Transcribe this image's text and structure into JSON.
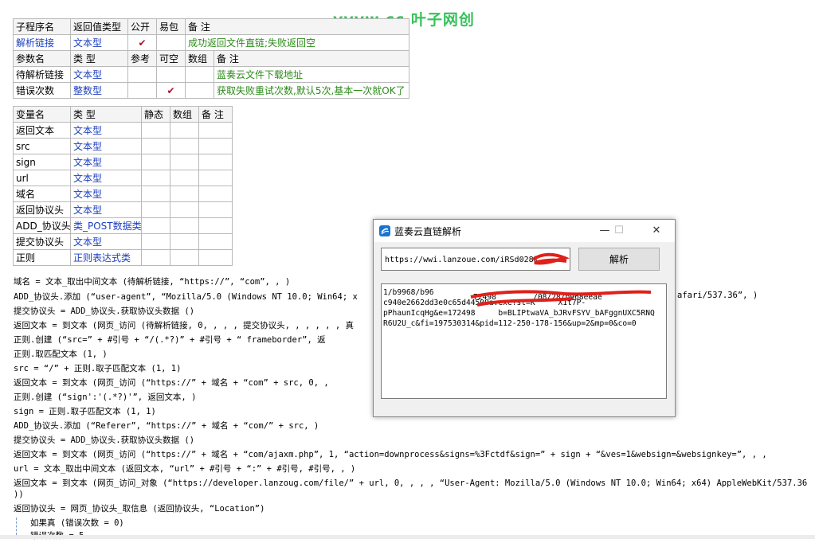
{
  "watermark": "vvvw.cc 叶子网创",
  "sub_table": {
    "headers": [
      "子程序名",
      "返回值类型",
      "公开",
      "易包",
      "备 注"
    ],
    "row": {
      "name": "解析链接",
      "type": "文本型",
      "public": "✔",
      "note": "成功返回文件直链;失败返回空"
    },
    "param_headers": [
      "参数名",
      "类 型",
      "参考",
      "可空",
      "数组",
      "备 注"
    ],
    "params": [
      {
        "name": "待解析链接",
        "type": "文本型",
        "note": "蓝奏云文件下载地址"
      },
      {
        "name": "错误次数",
        "type": "整数型",
        "nullable": "✔",
        "note": "获取失败重试次数,默认5次,基本一次就OK了"
      }
    ]
  },
  "var_table": {
    "headers": [
      "变量名",
      "类 型",
      "静态",
      "数组",
      "备 注"
    ],
    "rows": [
      {
        "name": "返回文本",
        "type": "文本型"
      },
      {
        "name": "src",
        "type": "文本型"
      },
      {
        "name": "sign",
        "type": "文本型"
      },
      {
        "name": "url",
        "type": "文本型"
      },
      {
        "name": "域名",
        "type": "文本型"
      },
      {
        "name": "返回协议头",
        "type": "文本型"
      },
      {
        "name": "ADD_协议头",
        "type": "类_POST数据类"
      },
      {
        "name": "提交协议头",
        "type": "文本型"
      },
      {
        "name": "正则",
        "type": "正则表达式类"
      }
    ]
  },
  "code_lines": [
    "域名 = 文本_取出中间文本 (待解析链接, “https://”, “com”, , )",
    "ADD_协议头.添加 (“user-agent”, “Mozilla/5.0 (Windows NT 10.0; Win64; x",
    "提交协议头 = ADD_协议头.获取协议头数据 ()",
    "返回文本 = 到文本 (网页_访问 (待解析链接, 0, , , , 提交协议头, , , , , , 真",
    "正则.创建 (“src=” + #引号 + “/(.*?)” + #引号 + “ frameborder”, 返",
    "正则.取匹配文本 (1, )",
    "src = “/” + 正则.取子匹配文本 (1, 1)",
    "返回文本 = 到文本 (网页_访问 (“https://” + 域名 + “com” + src, 0, ,",
    "正则.创建 (“sign':'(.*?)'”, 返回文本, )",
    "sign = 正则.取子匹配文本 (1, 1)",
    "ADD_协议头.添加 (“Referer”, “https://” + 域名 + “com/” + src, )",
    "提交协议头 = ADD_协议头.获取协议头数据 ()",
    "返回文本 = 到文本 (网页_访问 (“https://” + 域名 + “com/ajaxm.php”, 1, “action=downprocess&signs=%3Fctdf&sign=” + sign + “&ves=1&websign=&websignkey=”, , ,",
    "url = 文本_取出中间文本 (返回文本, “url” + #引号 + “:” + #引号, #引号, , )",
    "返回文本 = 到文本 (网页_访问_对象 (“https://developer.lanzoug.com/file/” + url, 0, , , , “User-Agent: Mozilla/5.0 (Windows NT 10.0; Win64; x64) AppleWebKit/537.36",
    "))",
    "返回协议头 = 网页_协议头_取信息 (返回协议头, “Location”)",
    "如果真 (错误次数 = 0)",
    "错误次数 = 5"
  ],
  "code_tail_right": "afari/537.36”, )",
  "window": {
    "title": "蓝奏云直链解析",
    "minimize": "—",
    "maximize": "☐",
    "close": "✕",
    "url_value": "https://wwi.lanzoue.com/iRSd028k",
    "parse_label": "解析",
    "result_lines": [
      "1/b9968/b96",
      "c940e2662dd3e0c65d44500a.exe?st=K     X1t7P-",
      "pPhaunIcqHg&e=172498     b=BLIPtwaVA_bJRvFSYV_bAFggnUXC5RNQ",
      "R6U2U_c&fi=197530314&pid=112-250-178-156&up=2&mp=0&co=0"
    ],
    "result_top_right": "72498        /08/28/b968eeae"
  }
}
